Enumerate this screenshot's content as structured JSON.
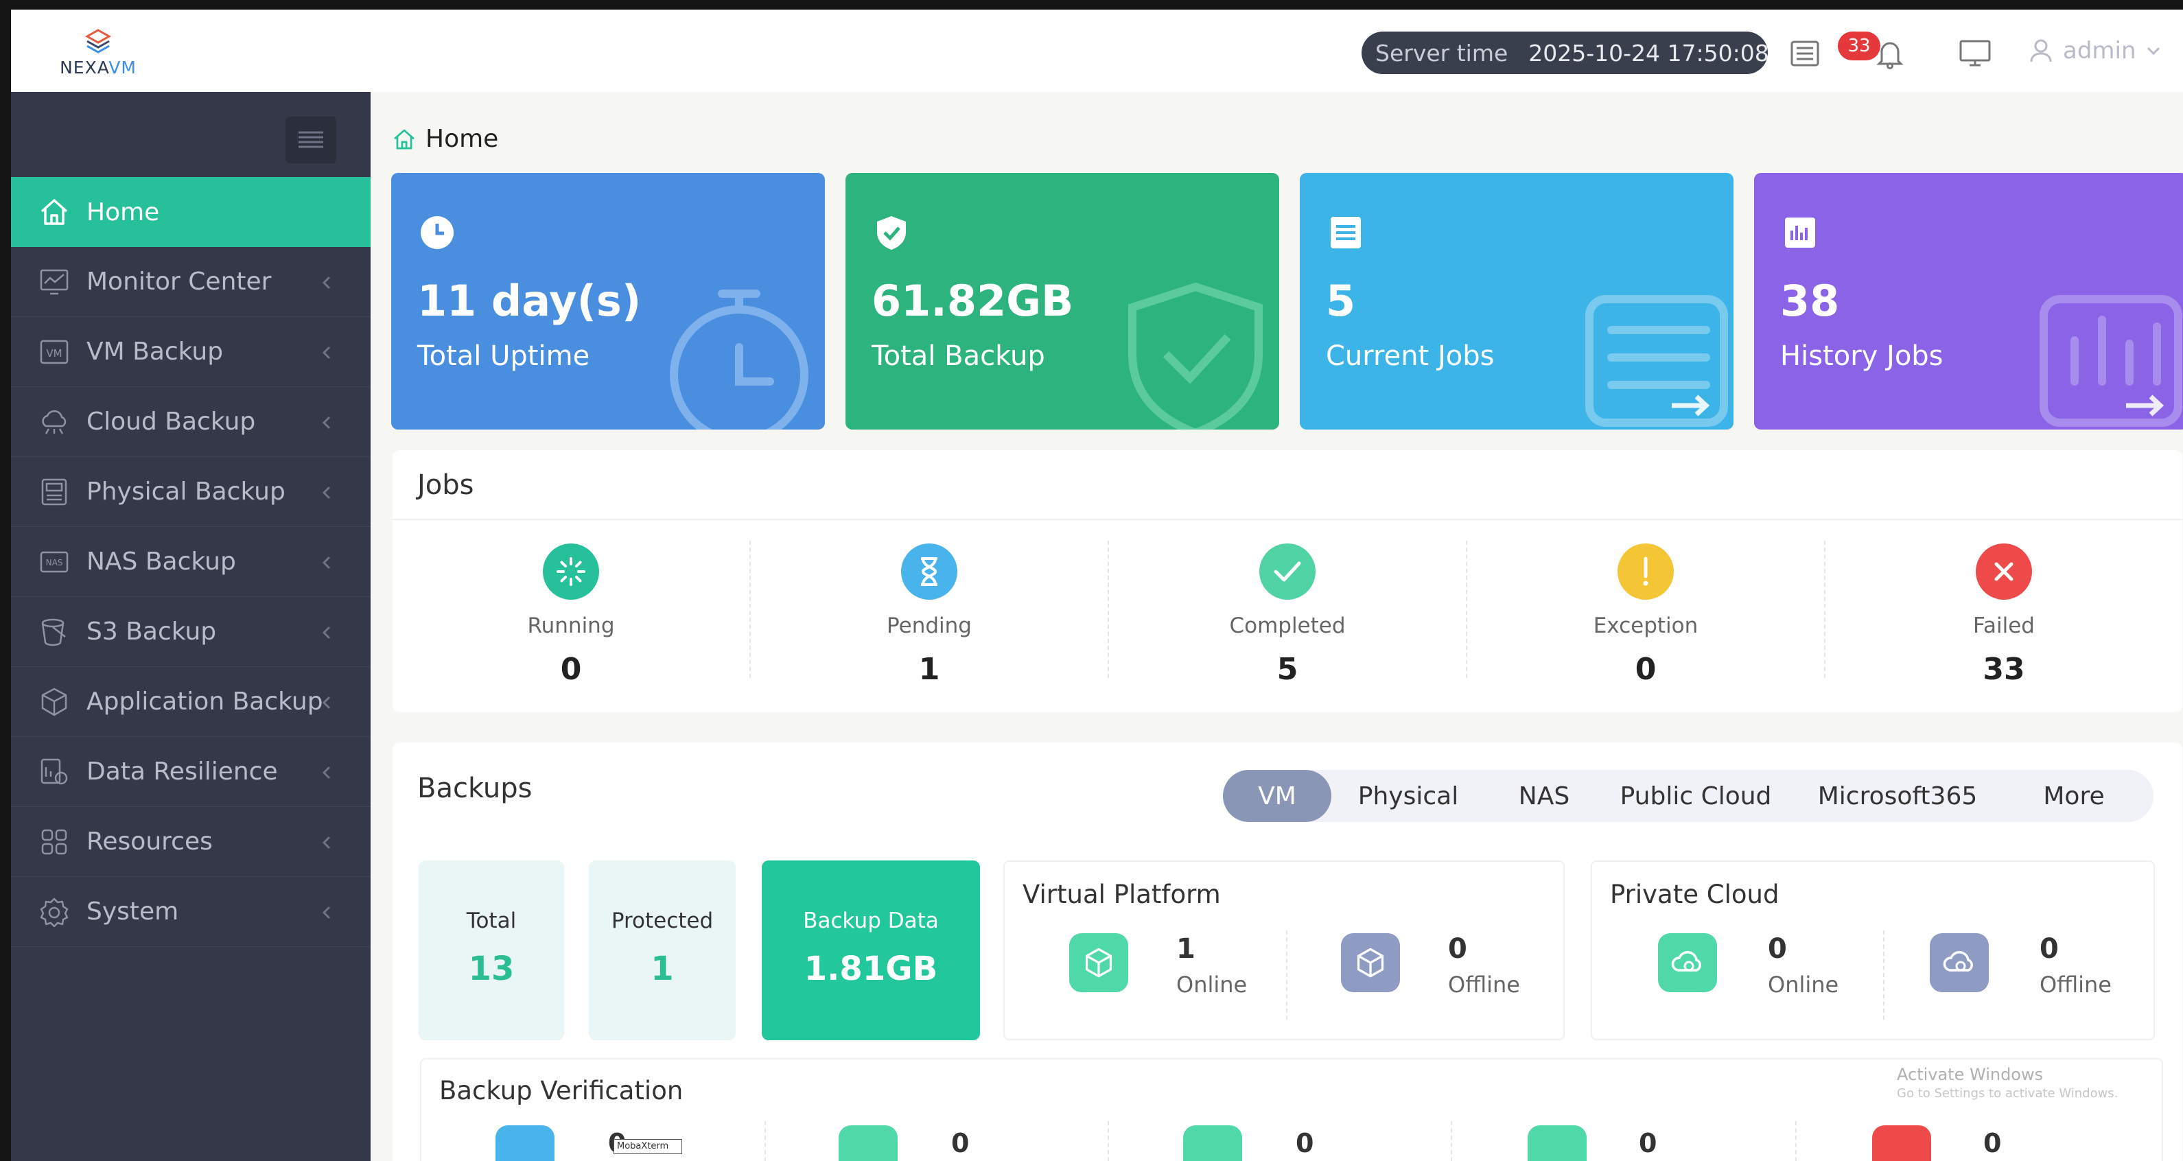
{
  "brand": {
    "name_part1": "NEXA",
    "name_part2": "VM"
  },
  "topbar": {
    "server_time_label": "Server time",
    "server_time_value": "2025-10-24 17:50:08",
    "notification_count": "33",
    "user": "admin"
  },
  "sidebar": {
    "items": [
      {
        "label": "Home",
        "icon": "home-icon",
        "active": true
      },
      {
        "label": "Monitor Center",
        "icon": "monitor-chart-icon"
      },
      {
        "label": "VM Backup",
        "icon": "vm-icon"
      },
      {
        "label": "Cloud Backup",
        "icon": "cloud-icon"
      },
      {
        "label": "Physical Backup",
        "icon": "server-icon"
      },
      {
        "label": "NAS Backup",
        "icon": "nas-icon"
      },
      {
        "label": "S3 Backup",
        "icon": "bucket-icon"
      },
      {
        "label": "Application Backup",
        "icon": "app-cube-icon"
      },
      {
        "label": "Data Resilience",
        "icon": "resilience-icon"
      },
      {
        "label": "Resources",
        "icon": "grid-icon"
      },
      {
        "label": "System",
        "icon": "gear-icon"
      }
    ]
  },
  "breadcrumb": {
    "home": "Home"
  },
  "stats": [
    {
      "value": "11 day(s)",
      "label": "Total Uptime",
      "color": "#4a8ee0",
      "icon": "clock-icon"
    },
    {
      "value": "61.82GB",
      "label": "Total Backup",
      "color": "#2db37e",
      "icon": "shield-check-icon"
    },
    {
      "value": "5",
      "label": "Current Jobs",
      "color": "#3db4e8",
      "icon": "list-icon"
    },
    {
      "value": "38",
      "label": "History Jobs",
      "color": "#8b63e6",
      "icon": "bar-chart-icon"
    }
  ],
  "jobs": {
    "title": "Jobs",
    "items": [
      {
        "label": "Running",
        "value": "0",
        "color": "#26c19a",
        "icon": "spinner-icon"
      },
      {
        "label": "Pending",
        "value": "1",
        "color": "#49b3ec",
        "icon": "hourglass-icon"
      },
      {
        "label": "Completed",
        "value": "5",
        "color": "#4fd3a2",
        "icon": "check-icon"
      },
      {
        "label": "Exception",
        "value": "0",
        "color": "#f4c534",
        "icon": "exclamation-icon"
      },
      {
        "label": "Failed",
        "value": "33",
        "color": "#ee4a4a",
        "icon": "x-icon"
      }
    ]
  },
  "backups": {
    "title": "Backups",
    "tabs": [
      "VM",
      "Physical",
      "NAS",
      "Public Cloud",
      "Microsoft365",
      "More"
    ],
    "active_tab": "VM",
    "total_label": "Total",
    "total_value": "13",
    "protected_label": "Protected",
    "protected_value": "1",
    "data_label": "Backup Data",
    "data_value": "1.81GB",
    "virtual_platform": {
      "title": "Virtual Platform",
      "online": "1",
      "online_label": "Online",
      "offline": "0",
      "offline_label": "Offline"
    },
    "private_cloud": {
      "title": "Private Cloud",
      "online": "0",
      "online_label": "Online",
      "offline": "0",
      "offline_label": "Offline"
    },
    "verification": {
      "title": "Backup Verification",
      "values": [
        "0",
        "0",
        "0",
        "0",
        "0"
      ],
      "overlay": "MobaXterm"
    }
  },
  "watermark": {
    "line1": "Activate Windows",
    "line2": "Go to Settings to activate Windows."
  }
}
